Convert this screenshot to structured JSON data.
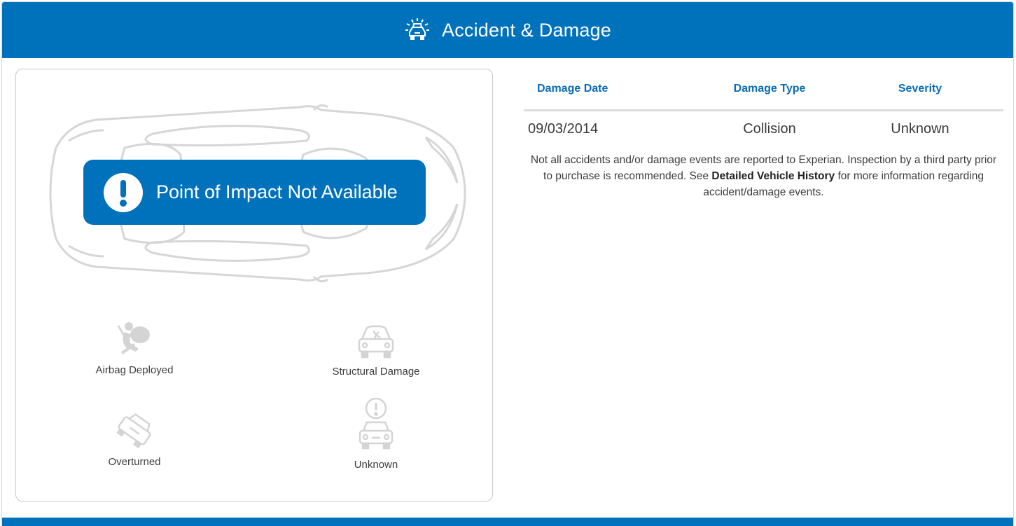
{
  "header": {
    "title": "Accident & Damage",
    "icon": "car-crash-icon",
    "color": "#0072bc"
  },
  "diagram": {
    "banner_text": "Point of Impact Not Available",
    "banner_icon": "exclamation-icon",
    "legend": [
      {
        "label": "Airbag Deployed",
        "icon": "airbag-icon"
      },
      {
        "label": "Structural Damage",
        "icon": "structural-damage-icon"
      },
      {
        "label": "Overturned",
        "icon": "overturned-car-icon"
      },
      {
        "label": "Unknown",
        "icon": "unknown-damage-icon"
      }
    ]
  },
  "table": {
    "headers": [
      "Damage Date",
      "Damage Type",
      "Severity"
    ],
    "rows": [
      [
        "09/03/2014",
        "Collision",
        "Unknown"
      ]
    ]
  },
  "note": {
    "text_before": "Not all accidents and/or damage events are reported to Experian. Inspection by a third party prior to purchase is recommended. See ",
    "link_text": "Detailed Vehicle History",
    "text_after": " for more information regarding accident/damage events."
  }
}
